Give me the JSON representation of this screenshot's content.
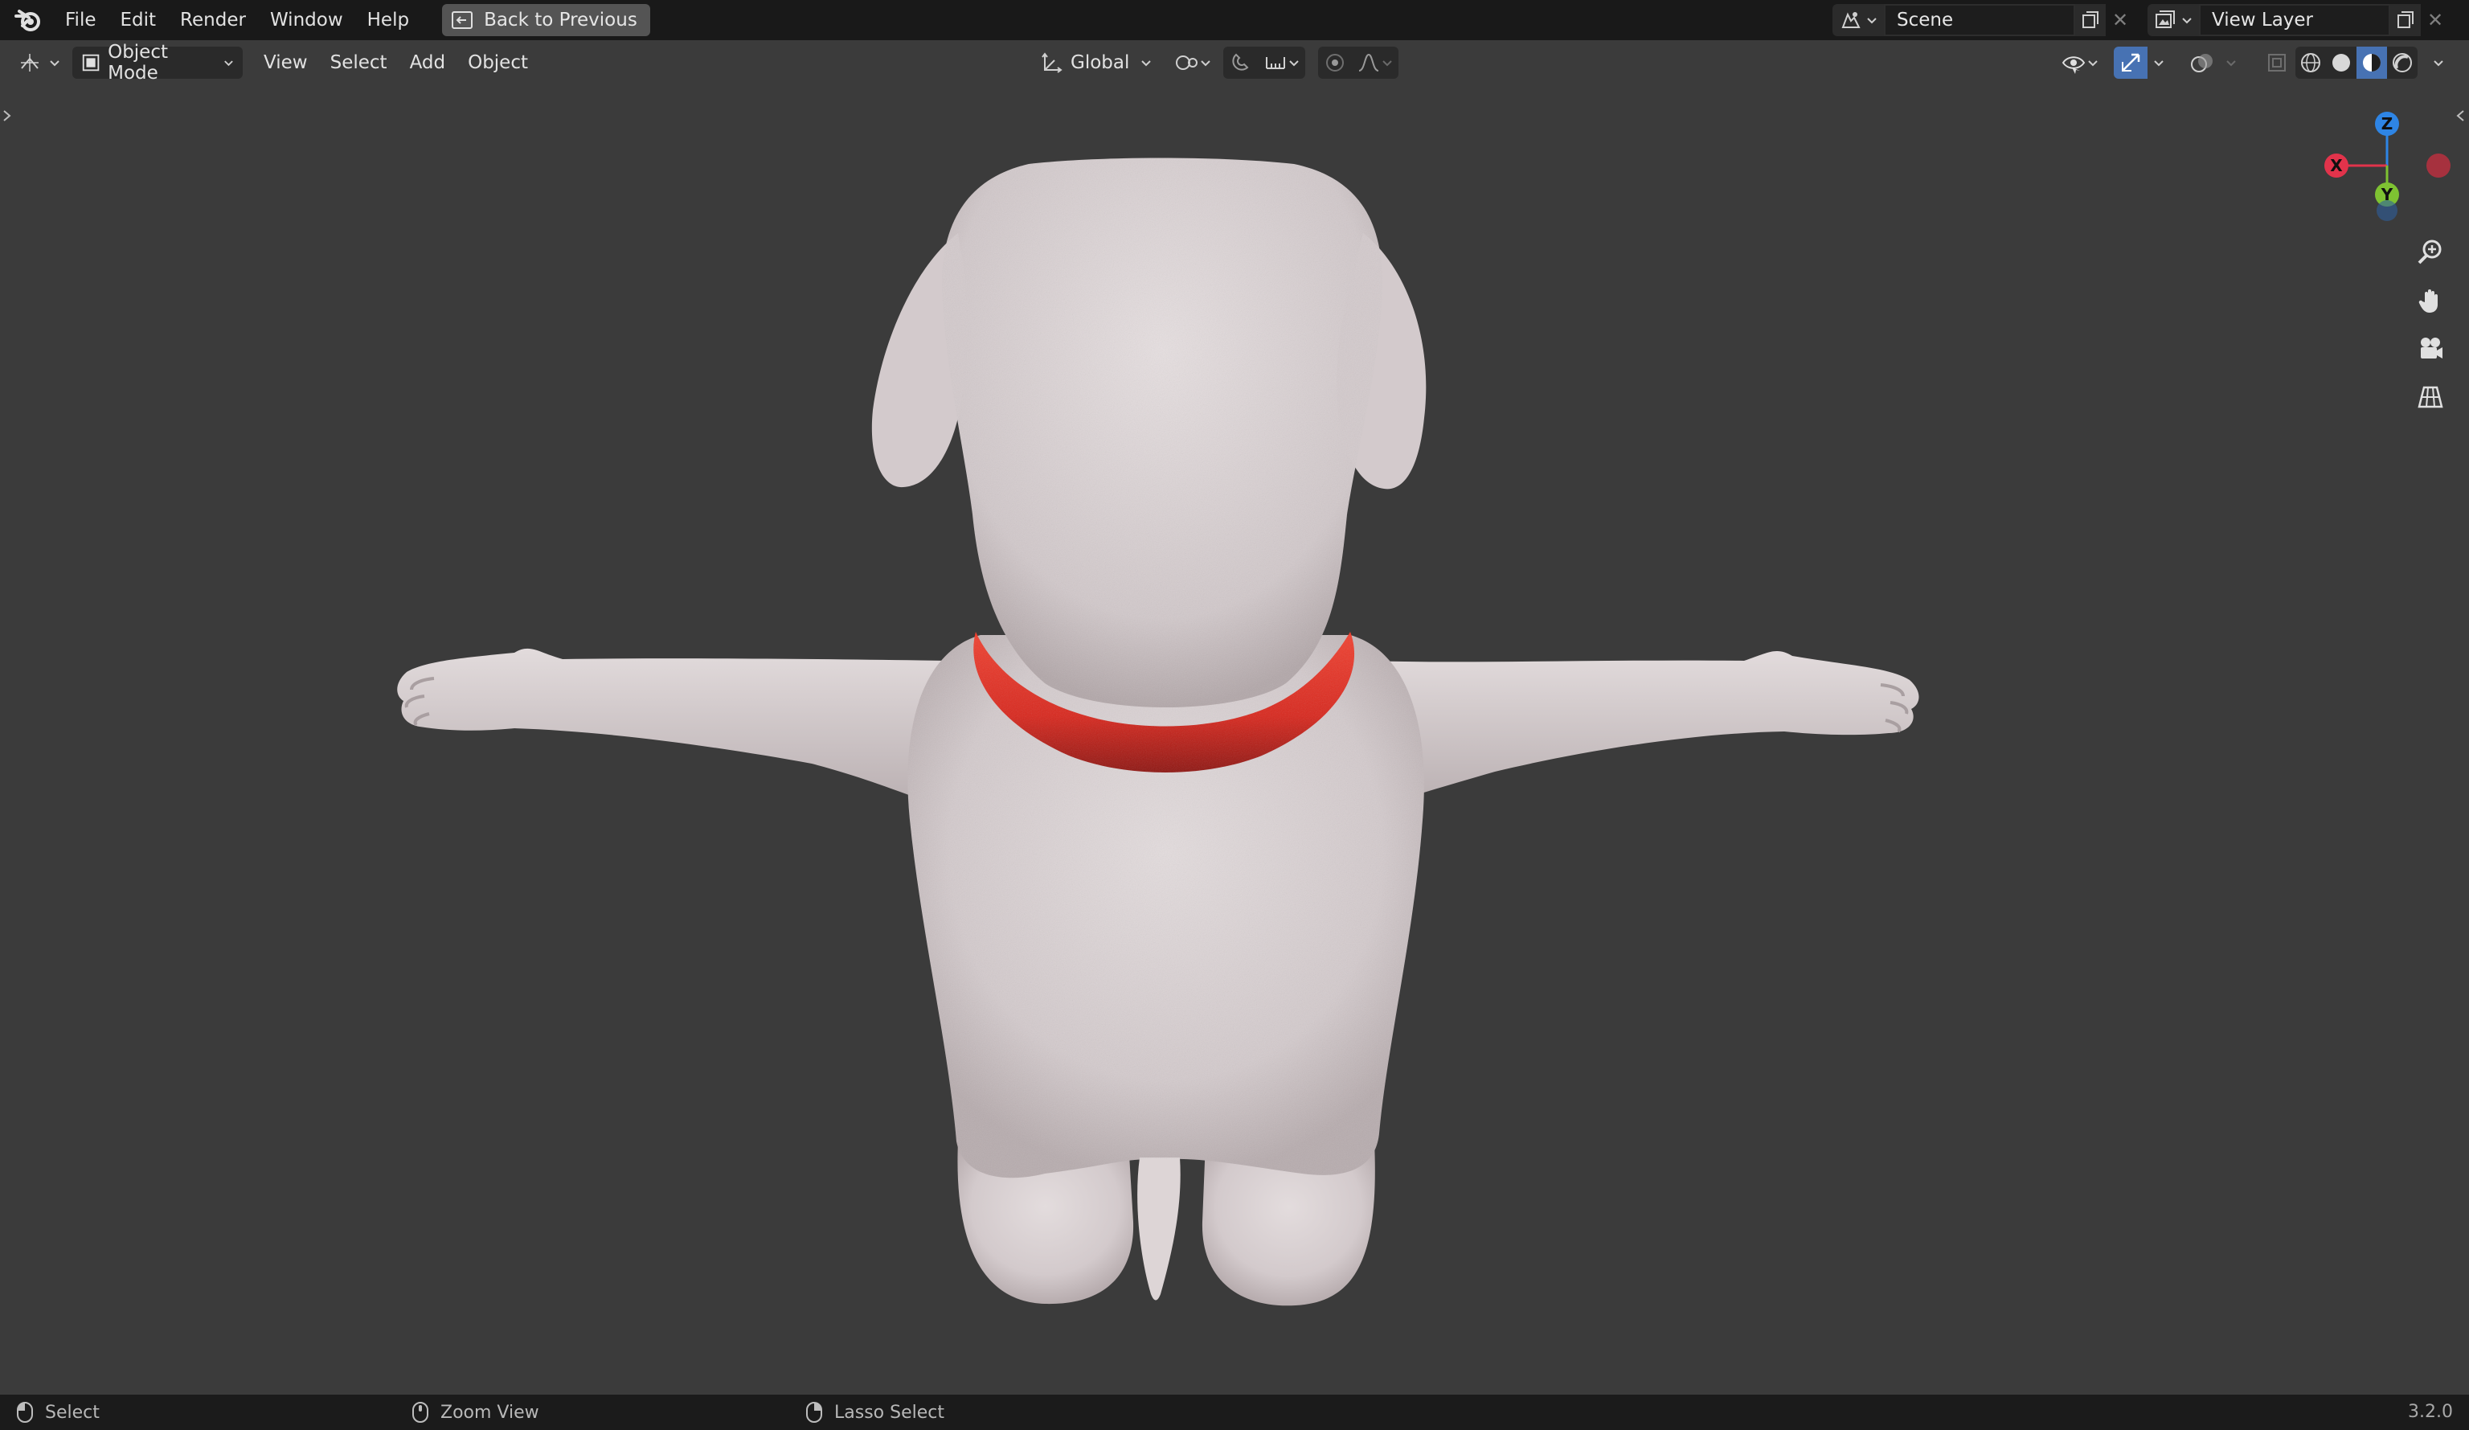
{
  "topbar": {
    "menus": [
      "File",
      "Edit",
      "Render",
      "Window",
      "Help"
    ],
    "back_button": "Back to Previous",
    "scene_name": "Scene",
    "view_layer_name": "View Layer"
  },
  "viewheader": {
    "mode": "Object Mode",
    "menus": [
      "View",
      "Select",
      "Add",
      "Object"
    ],
    "transform_orientation": "Global"
  },
  "gizmo": {
    "z_label": "Z",
    "x_label": "X",
    "y_label": "Y",
    "colors": {
      "x": "#e2334b",
      "y": "#7ec232",
      "z": "#2e85e5"
    }
  },
  "statusbar": {
    "left_action": "Select",
    "middle_action": "Zoom View",
    "right_action": "Lasso Select",
    "version": "3.2.0"
  },
  "colors": {
    "accent_blue": "#4772b3",
    "collar_red": "#d8261c",
    "body_white": "#d9d2d3"
  },
  "icons": [
    "blender-logo-icon",
    "back-icon",
    "scene-icon",
    "view-layer-icon",
    "new-icon",
    "close-icon",
    "editor-type-icon",
    "object-mode-icon",
    "orientation-icon",
    "pivot-icon",
    "snap-icon",
    "proportional-icon",
    "visibility-icon",
    "gizmo-icon",
    "overlay-icon",
    "xray-icon",
    "shading-wireframe-icon",
    "shading-solid-icon",
    "shading-material-icon",
    "shading-rendered-icon",
    "zoom-icon",
    "pan-hand-icon",
    "camera-icon",
    "grid-icon",
    "mouse-icon"
  ]
}
